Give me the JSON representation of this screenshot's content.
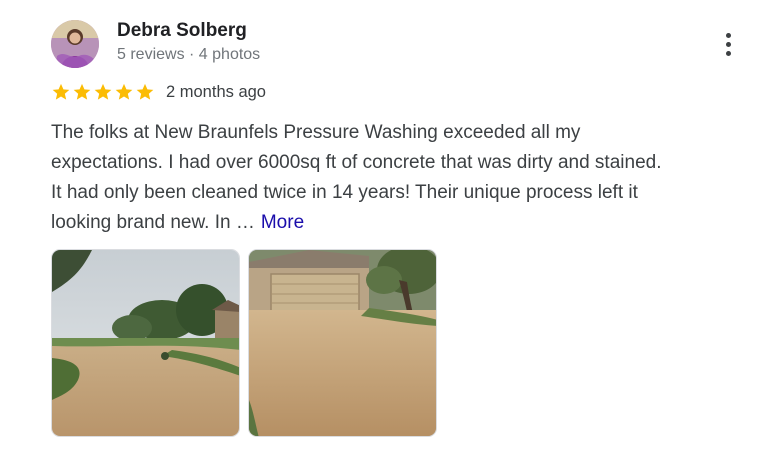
{
  "reviewer": {
    "name": "Debra Solberg",
    "meta": "5 reviews · 4 photos",
    "avatar_icon": "profile-photo"
  },
  "rating": {
    "stars": 5,
    "max_stars": 5,
    "star_color": "#fbbc04",
    "date": "2 months ago"
  },
  "review": {
    "lines": [
      "The folks at New Braunfels Pressure Washing exceeded all my",
      "expectations. I had over 6000sq ft of concrete that was dirty and stained.",
      "It had only been cleaned twice in 14 years! Their unique process left it",
      "looking brand new. In …"
    ],
    "more_label": "More",
    "link_color": "#1a0dab"
  },
  "menu": {
    "icon": "more-vert-icon"
  },
  "photos": [
    {
      "icon": "photo-driveway-trees"
    },
    {
      "icon": "photo-driveway-garage"
    }
  ]
}
